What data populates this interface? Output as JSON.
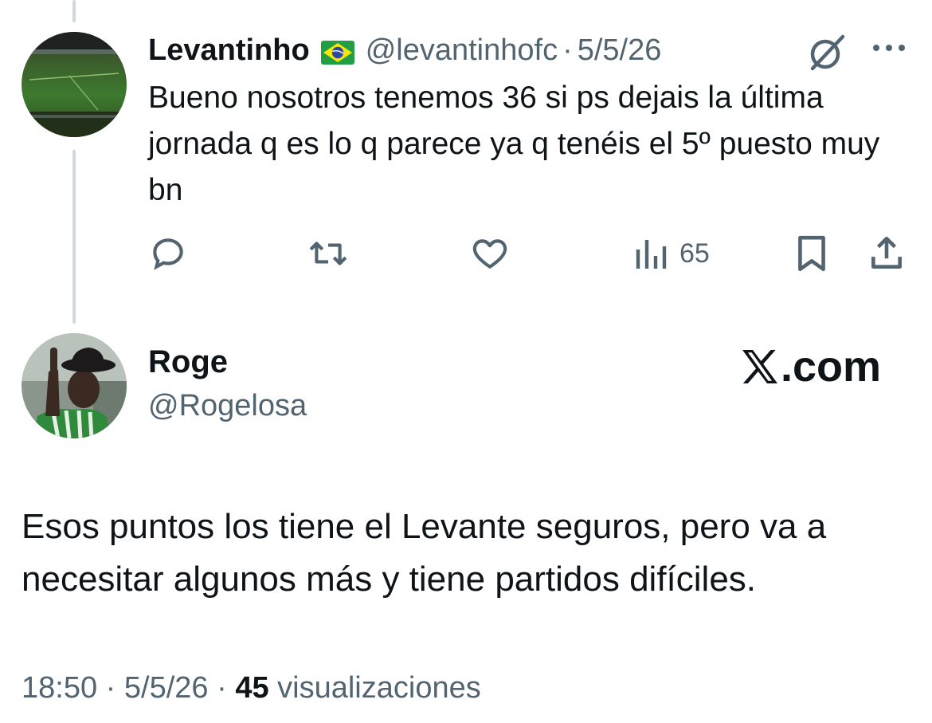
{
  "parent_tweet": {
    "display_name": "Levantinho",
    "flag_icon": "brazil-flag-icon",
    "handle": "@levantinhofc",
    "separator": "·",
    "date": "5/5/26",
    "text": "Bueno nosotros tenemos 36 si ps dejais la última jornada q es lo q parece ya q tenéis el 5º puesto muy bn",
    "actions": {
      "reply_icon": "reply-icon",
      "retweet_icon": "retweet-icon",
      "like_icon": "heart-icon",
      "views_icon": "views-icon",
      "views_count": "65",
      "bookmark_icon": "bookmark-icon",
      "share_icon": "share-icon"
    }
  },
  "main_tweet": {
    "display_name": "Roge",
    "handle": "@Rogelosa",
    "watermark": ".com",
    "text": "Esos puntos los tiene el Levante seguros, pero va a necesitar algunos más y tiene partidos difíciles.",
    "time": "18:50",
    "separator": "·",
    "date": "5/5/26",
    "views_count": "45",
    "views_label": "visualizaciones"
  },
  "colors": {
    "text_primary": "#0f1419",
    "text_secondary": "#536471",
    "thread_line": "#cfd9de"
  }
}
